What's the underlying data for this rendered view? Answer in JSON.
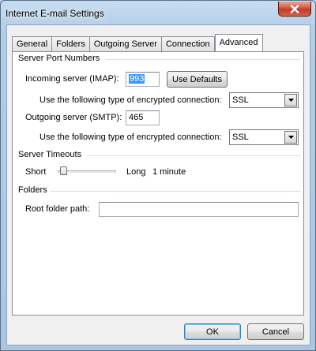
{
  "window": {
    "title": "Internet E-mail Settings"
  },
  "tabs": [
    {
      "label": "General",
      "active": false
    },
    {
      "label": "Folders",
      "active": false
    },
    {
      "label": "Outgoing Server",
      "active": false
    },
    {
      "label": "Connection",
      "active": false
    },
    {
      "label": "Advanced",
      "active": true
    }
  ],
  "server_ports": {
    "heading": "Server Port Numbers",
    "incoming_label": "Incoming server (IMAP):",
    "incoming_value": "993",
    "use_defaults_label": "Use Defaults",
    "incoming_encryption_label": "Use the following type of encrypted connection:",
    "incoming_encryption_value": "SSL",
    "outgoing_label": "Outgoing server (SMTP):",
    "outgoing_value": "465",
    "outgoing_encryption_label": "Use the following type of encrypted connection:",
    "outgoing_encryption_value": "SSL"
  },
  "timeouts": {
    "heading": "Server Timeouts",
    "short_label": "Short",
    "long_label": "Long",
    "value_label": "1 minute",
    "slider_position": 0.05
  },
  "folders": {
    "heading": "Folders",
    "root_label": "Root folder path:",
    "root_value": ""
  },
  "buttons": {
    "ok_label": "OK",
    "cancel_label": "Cancel"
  },
  "icons": {
    "close": "close-icon",
    "combo_arrow": "chevron-down-icon"
  }
}
